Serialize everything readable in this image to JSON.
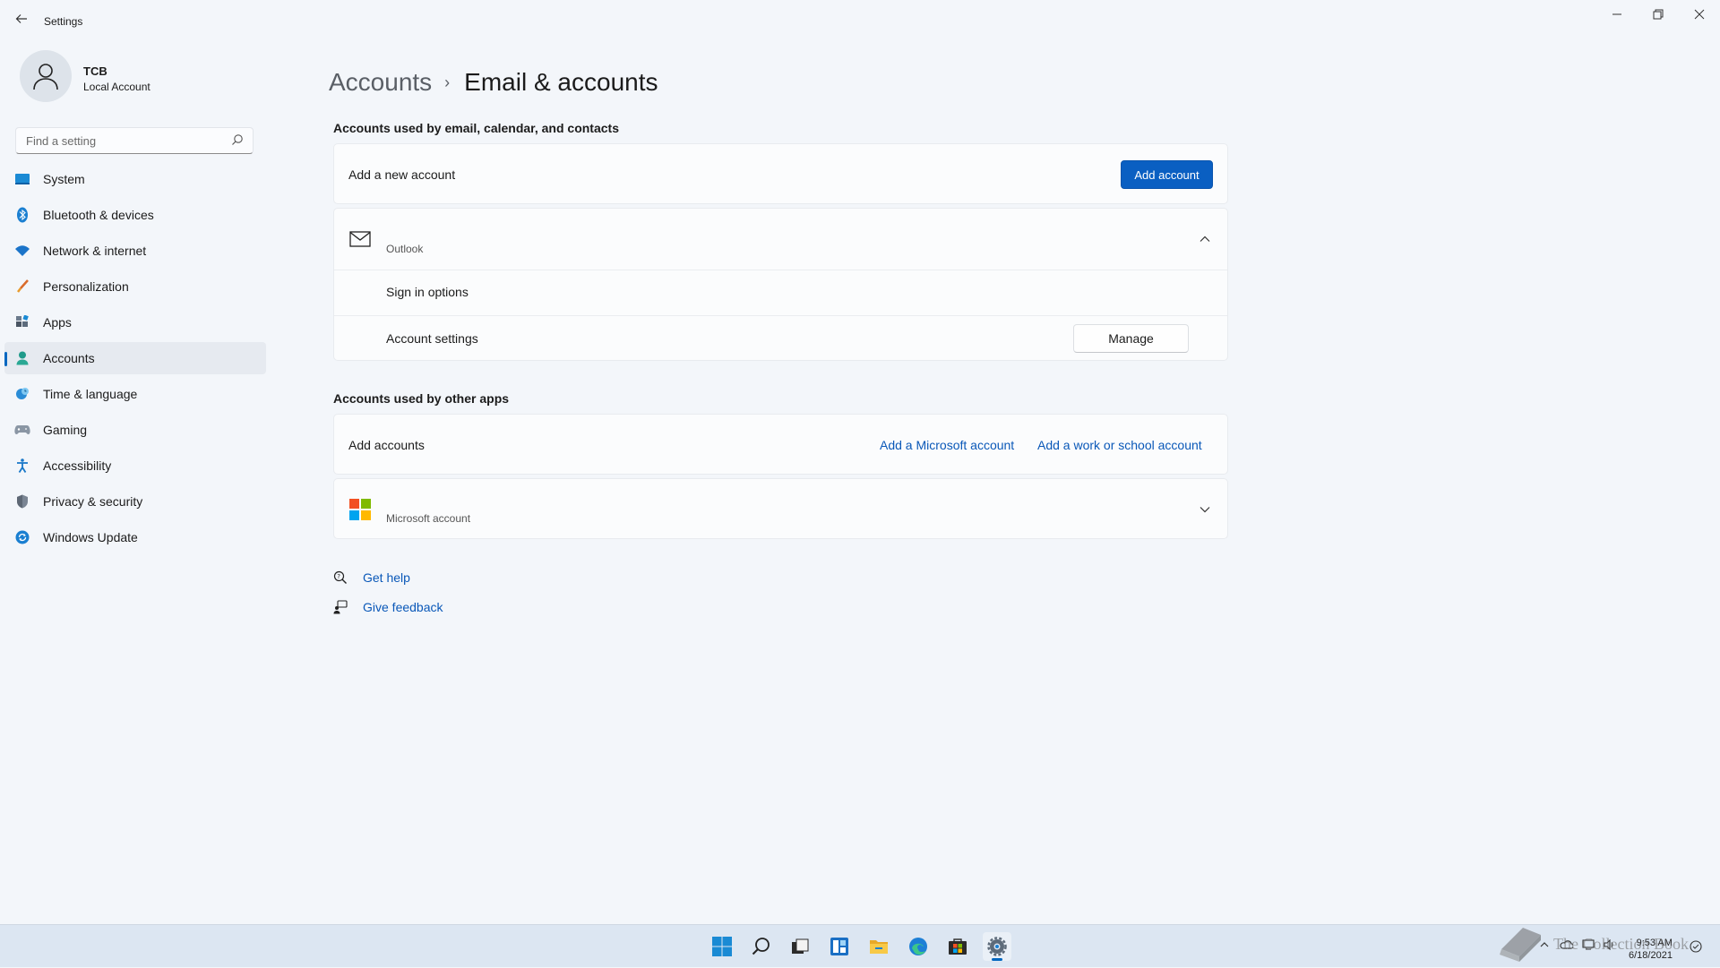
{
  "window": {
    "title": "Settings",
    "controls": {
      "minimize": "–",
      "maximize": "▢",
      "close": "✕"
    }
  },
  "user": {
    "name": "TCB",
    "account_type": "Local Account"
  },
  "search": {
    "placeholder": "Find a setting"
  },
  "sidebar": {
    "items": [
      {
        "label": "System",
        "icon": "system-icon",
        "active": false
      },
      {
        "label": "Bluetooth & devices",
        "icon": "bluetooth-icon",
        "active": false
      },
      {
        "label": "Network & internet",
        "icon": "wifi-icon",
        "active": false
      },
      {
        "label": "Personalization",
        "icon": "brush-icon",
        "active": false
      },
      {
        "label": "Apps",
        "icon": "apps-icon",
        "active": false
      },
      {
        "label": "Accounts",
        "icon": "person-icon",
        "active": true
      },
      {
        "label": "Time & language",
        "icon": "globe-clock-icon",
        "active": false
      },
      {
        "label": "Gaming",
        "icon": "gamepad-icon",
        "active": false
      },
      {
        "label": "Accessibility",
        "icon": "accessibility-icon",
        "active": false
      },
      {
        "label": "Privacy & security",
        "icon": "shield-icon",
        "active": false
      },
      {
        "label": "Windows Update",
        "icon": "update-icon",
        "active": false
      }
    ]
  },
  "breadcrumb": {
    "parent": "Accounts",
    "separator": "›",
    "current": "Email & accounts"
  },
  "email_section": {
    "title": "Accounts used by email, calendar, and contacts",
    "add_row": {
      "label": "Add a new account",
      "button": "Add account"
    },
    "outlook": {
      "name": "Outlook",
      "sign_in_options": "Sign in options",
      "account_settings": "Account settings",
      "manage_button": "Manage"
    }
  },
  "other_apps_section": {
    "title": "Accounts used by other apps",
    "add_row": {
      "label": "Add accounts",
      "microsoft_link": "Add a Microsoft account",
      "work_link": "Add a work or school account"
    },
    "microsoft": {
      "name": "Microsoft account"
    }
  },
  "help": {
    "get_help": "Get help",
    "give_feedback": "Give feedback"
  },
  "taskbar": {
    "apps": [
      "start-icon",
      "search-icon",
      "task-view-icon",
      "widgets-icon",
      "file-explorer-icon",
      "edge-icon",
      "store-icon",
      "settings-icon"
    ],
    "clock_time": "9:53 AM",
    "clock_date": "6/18/2021"
  },
  "watermark": {
    "text": "The Collection Book"
  },
  "colors": {
    "accent": "#0067c0",
    "primary_button": "#0a5fc2",
    "link": "#0a58b8",
    "background": "#f3f6fa"
  }
}
